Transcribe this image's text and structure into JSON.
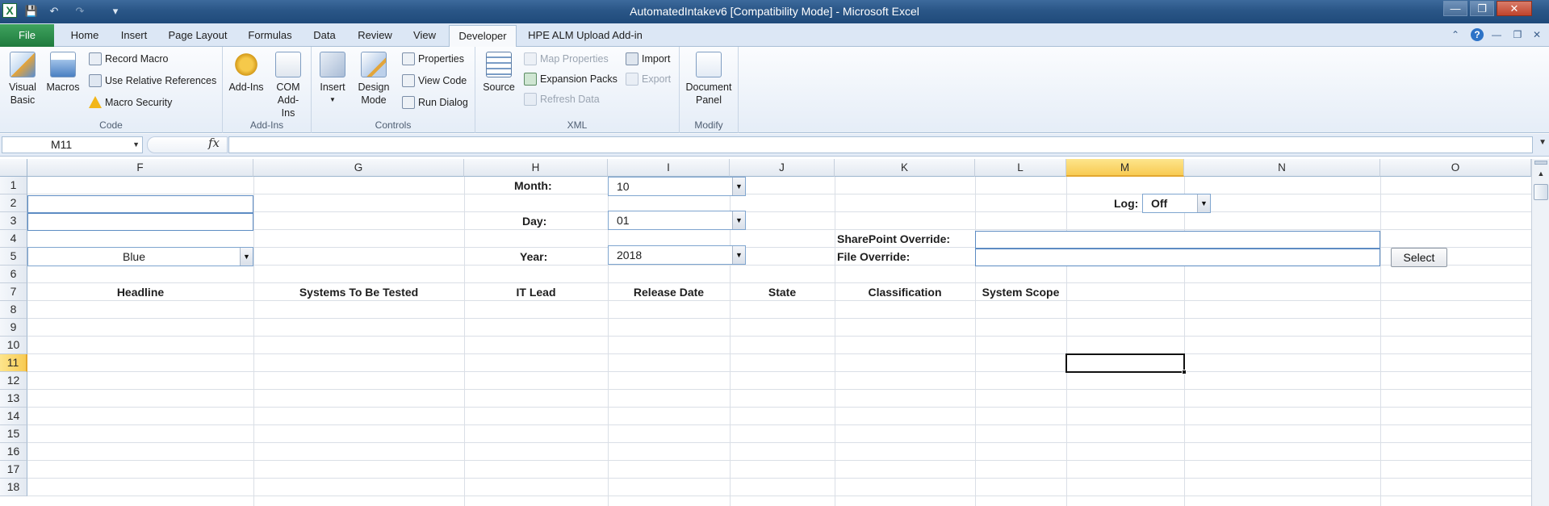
{
  "window": {
    "title": "AutomatedIntakev6  [Compatibility Mode]  -  Microsoft Excel",
    "app_icon": "excel-icon",
    "quick_access": [
      "save-icon",
      "undo-icon",
      "redo-icon",
      "customize-icon"
    ],
    "controls": [
      "minimize-icon",
      "restore-icon",
      "close-icon"
    ]
  },
  "ribbon": {
    "file_tab": "File",
    "tabs": [
      "Home",
      "Insert",
      "Page Layout",
      "Formulas",
      "Data",
      "Review",
      "View",
      "Developer",
      "HPE ALM Upload Add-in"
    ],
    "active_tab": "Developer",
    "groups": {
      "code": {
        "label": "Code",
        "visual_basic": "Visual Basic",
        "macros": "Macros",
        "record_macro": "Record Macro",
        "use_relative": "Use Relative References",
        "macro_security": "Macro Security"
      },
      "addins": {
        "label": "Add-Ins",
        "addins": "Add-Ins",
        "com_addins": "COM Add-Ins"
      },
      "controls": {
        "label": "Controls",
        "insert": "Insert",
        "design_mode": "Design Mode",
        "properties": "Properties",
        "view_code": "View Code",
        "run_dialog": "Run Dialog"
      },
      "xml": {
        "label": "XML",
        "source": "Source",
        "map_properties": "Map Properties",
        "expansion_packs": "Expansion Packs",
        "refresh_data": "Refresh Data",
        "import": "Import",
        "export": "Export"
      },
      "modify": {
        "label": "Modify",
        "document_panel": "Document Panel"
      }
    }
  },
  "formula_bar": {
    "name_box": "M11",
    "fx": "fx",
    "formula": ""
  },
  "sheet": {
    "columns": [
      "F",
      "G",
      "H",
      "I",
      "J",
      "K",
      "L",
      "M",
      "N",
      "O"
    ],
    "selected_column": "M",
    "rows": [
      "1",
      "2",
      "3",
      "4",
      "5",
      "6",
      "7",
      "8",
      "9",
      "10",
      "11",
      "12",
      "13",
      "14",
      "15",
      "16",
      "17",
      "18"
    ],
    "selected_row": "11",
    "active_cell": "M11",
    "labels": {
      "month": "Month:",
      "day": "Day:",
      "year": "Year:",
      "log": "Log:",
      "sharepoint_override": "SharePoint Override:",
      "file_override": "File Override:"
    },
    "controls": {
      "month_value": "10",
      "day_value": "01",
      "year_value": "2018",
      "log_value": "Off",
      "color_value": "Blue",
      "select_button": "Select"
    },
    "headers": [
      "Headline",
      "Systems To Be Tested",
      "IT Lead",
      "Release Date",
      "State",
      "Classification",
      "System Scope"
    ]
  }
}
